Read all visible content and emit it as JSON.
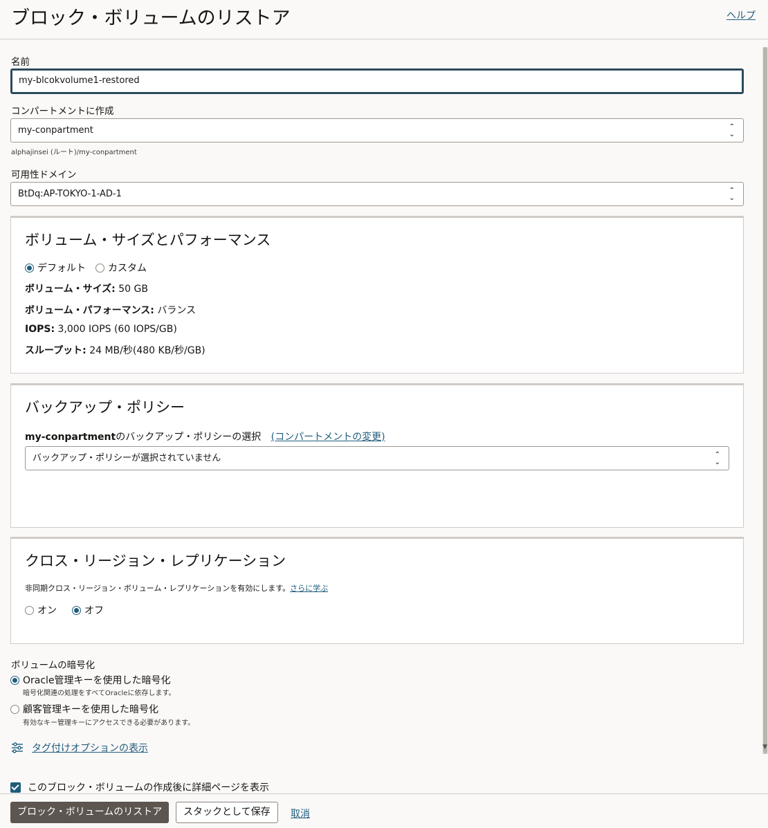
{
  "header": {
    "title": "ブロック・ボリュームのリストア",
    "help_label": "ヘルプ"
  },
  "form": {
    "name": {
      "label": "名前",
      "value": "my-blcokvolume1-restored"
    },
    "compartment": {
      "label": "コンパートメントに作成",
      "value": "my-conpartment",
      "path": "alphajinsei (ルート)/my-conpartment"
    },
    "availability_domain": {
      "label": "可用性ドメイン",
      "value": "BtDq:AP-TOKYO-1-AD-1"
    }
  },
  "volume_size": {
    "title": "ボリューム・サイズとパフォーマンス",
    "options": [
      "デフォルト",
      "カスタム"
    ],
    "selected": "デフォルト",
    "size_label": "ボリューム・サイズ:",
    "size_value": " 50 GB",
    "perf_label": "ボリューム・パフォーマンス:",
    "perf_value": " バランス",
    "iops_label": "IOPS:",
    "iops_value": " 3,000 IOPS (60 IOPS/GB)",
    "throughput_label": "スループット:",
    "throughput_value": " 24 MB/秒(480 KB/秒/GB)"
  },
  "backup_policy": {
    "title": "バックアップ・ポリシー",
    "compartment_name": "my-conpartment",
    "select_suffix": "のバックアップ・ポリシーの選択",
    "change_link": "(コンパートメントの変更)",
    "select_value": "バックアップ・ポリシーが選択されていません"
  },
  "replication": {
    "title": "クロス・リージョン・レプリケーション",
    "description": "非同期クロス・リージョン・ボリューム・レプリケーションを有効にします。",
    "learn_more": "さらに学ぶ",
    "options": [
      "オン",
      "オフ"
    ],
    "selected": "オフ"
  },
  "encryption": {
    "label": "ボリュームの暗号化",
    "oracle_option": "Oracle管理キーを使用した暗号化",
    "oracle_desc": "暗号化関連の処理をすべてOracleに依存します。",
    "customer_option": "顧客管理キーを使用した暗号化",
    "customer_desc": "有効なキー管理キーにアクセスできる必要があります。",
    "selected": "oracle"
  },
  "tags_link": "タグ付けオプションの表示",
  "details_checkbox": "このブロック・ボリュームの作成後に詳細ページを表示",
  "footer": {
    "primary": "ブロック・ボリュームのリストア",
    "secondary": "スタックとして保存",
    "cancel": "取消"
  },
  "colors": {
    "accent": "#1f5c7c",
    "primary_button": "#5c5550"
  }
}
